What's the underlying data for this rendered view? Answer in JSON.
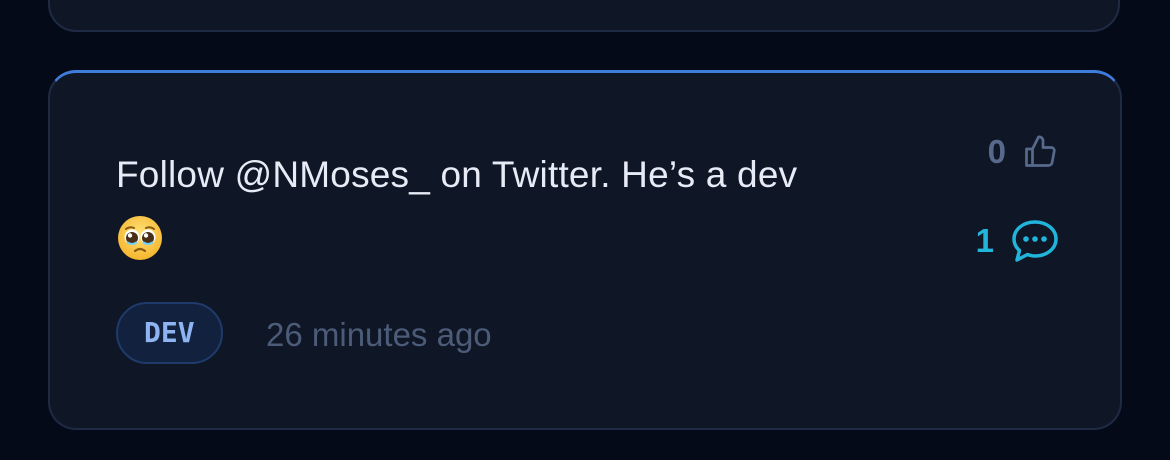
{
  "post": {
    "text": "Follow @NMoses_ on Twitter. He’s a dev",
    "emoji": "pleading-face",
    "tag": "DEV",
    "timestamp": "26 minutes ago",
    "likes": "0",
    "comments": "1"
  },
  "colors": {
    "background": "#040a18",
    "card": "#0f1626",
    "accent": "#3f7ddc",
    "comment_accent": "#22b5dc",
    "tag_text": "#8fb4f2"
  },
  "icons": {
    "like": "thumbs-up-icon",
    "comment": "chat-bubble-icon",
    "emoji": "pleading-face-emoji-icon"
  }
}
